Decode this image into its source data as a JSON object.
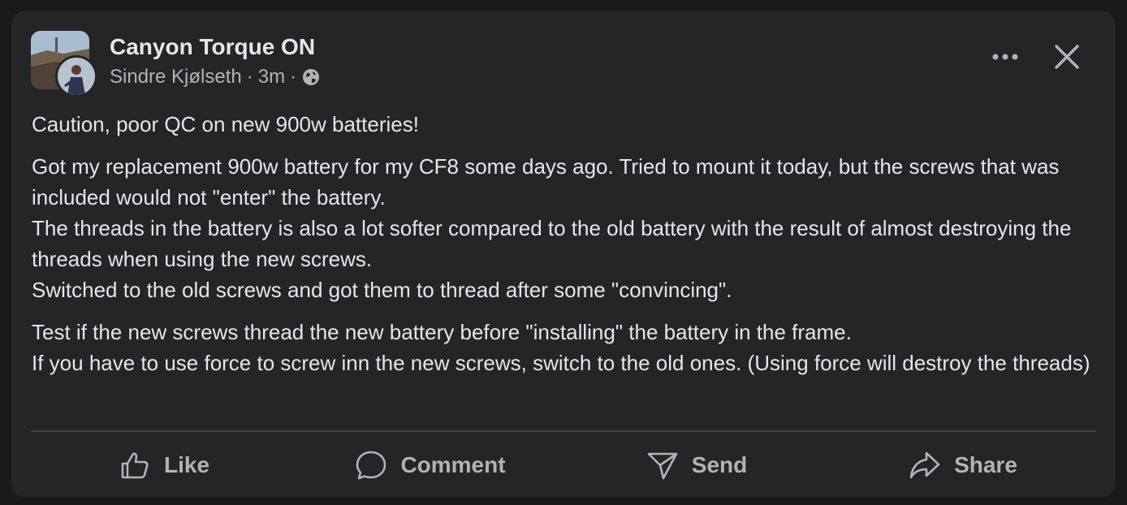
{
  "post": {
    "group_name": "Canyon Torque ON",
    "author": "Sindre Kjølseth",
    "separator": "·",
    "time": "3m",
    "privacy_icon": "globe-icon",
    "paragraphs": [
      "Caution, poor QC on new 900w batteries!",
      "Got my replacement 900w battery for my CF8 some days ago. Tried to mount it today, but the screws that was included would not \"enter\" the battery.\nThe threads in the battery is also a lot softer compared to the old battery with the result of almost destroying the threads when using the new screws.\nSwitched to the old screws and got them to thread after some \"convincing\".",
      "Test if the new screws thread the new battery before \"installing\" the battery in the frame.\nIf you have to use force to screw inn the new screws, switch to the old ones. (Using force will destroy the threads)"
    ]
  },
  "top_actions": {
    "more_icon": "more-horizontal-icon",
    "close_icon": "close-icon"
  },
  "actions": [
    {
      "label": "Like",
      "icon": "thumbs-up-icon"
    },
    {
      "label": "Comment",
      "icon": "comment-icon"
    },
    {
      "label": "Send",
      "icon": "send-icon"
    },
    {
      "label": "Share",
      "icon": "share-icon"
    }
  ],
  "colors": {
    "background": "#18191a",
    "card": "#242526",
    "primary_text": "#e4e6eb",
    "secondary_text": "#b0b3b8",
    "divider": "#3e4042"
  }
}
